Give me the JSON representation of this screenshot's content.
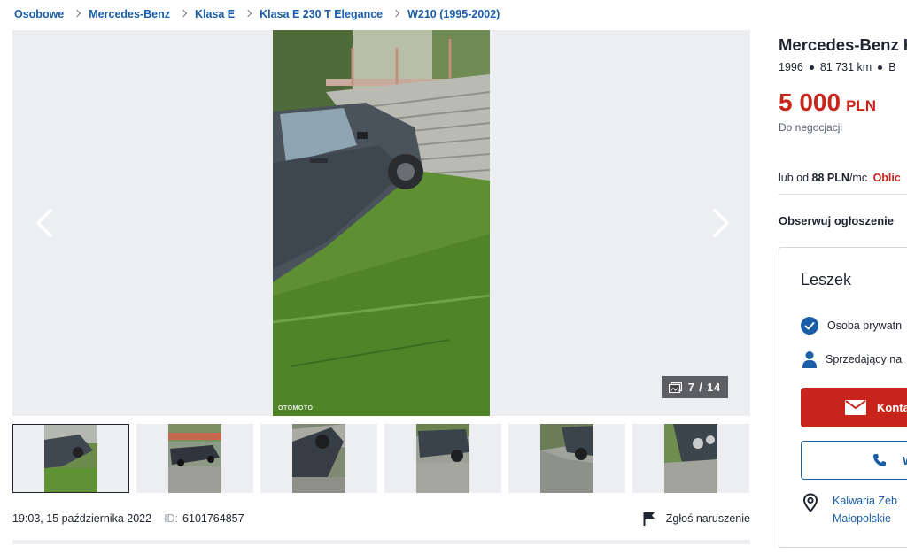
{
  "breadcrumb": [
    "Osobowe",
    "Mercedes-Benz",
    "Klasa E",
    "Klasa E 230 T Elegance",
    "W210 (1995-2002)"
  ],
  "gallery": {
    "counter": "7 / 14",
    "watermark": "OTOMOTO",
    "thumbnail_count": 6,
    "active_thumbnail": 1
  },
  "meta": {
    "date": "19:03, 15 października 2022",
    "id_label": "ID:",
    "id_value": "6101764857",
    "report_label": "Zgłoś naruszenie"
  },
  "listing": {
    "title": "Mercedes-Benz K",
    "year": "1996",
    "mileage": "81 731 km",
    "fuel": "B",
    "price": "5 000",
    "currency": "PLN",
    "negotiable": "Do negocjacji",
    "finance_prefix": "lub od",
    "finance_amount": "88 PLN",
    "finance_suffix": "/mc",
    "finance_link": "Oblic",
    "observe": "Obserwuj ogłoszenie"
  },
  "seller": {
    "name": "Leszek",
    "type": "Osoba prywatn",
    "since": "Sprzedający na",
    "contact_button": "Konta",
    "phone_button": "W",
    "location_line1": "Kalwaria Zeb",
    "location_line2": "Małopolskie"
  },
  "colors": {
    "accent_blue": "#1b5ea8",
    "price_red": "#c7251b",
    "gallery_bg": "#eceef2"
  }
}
